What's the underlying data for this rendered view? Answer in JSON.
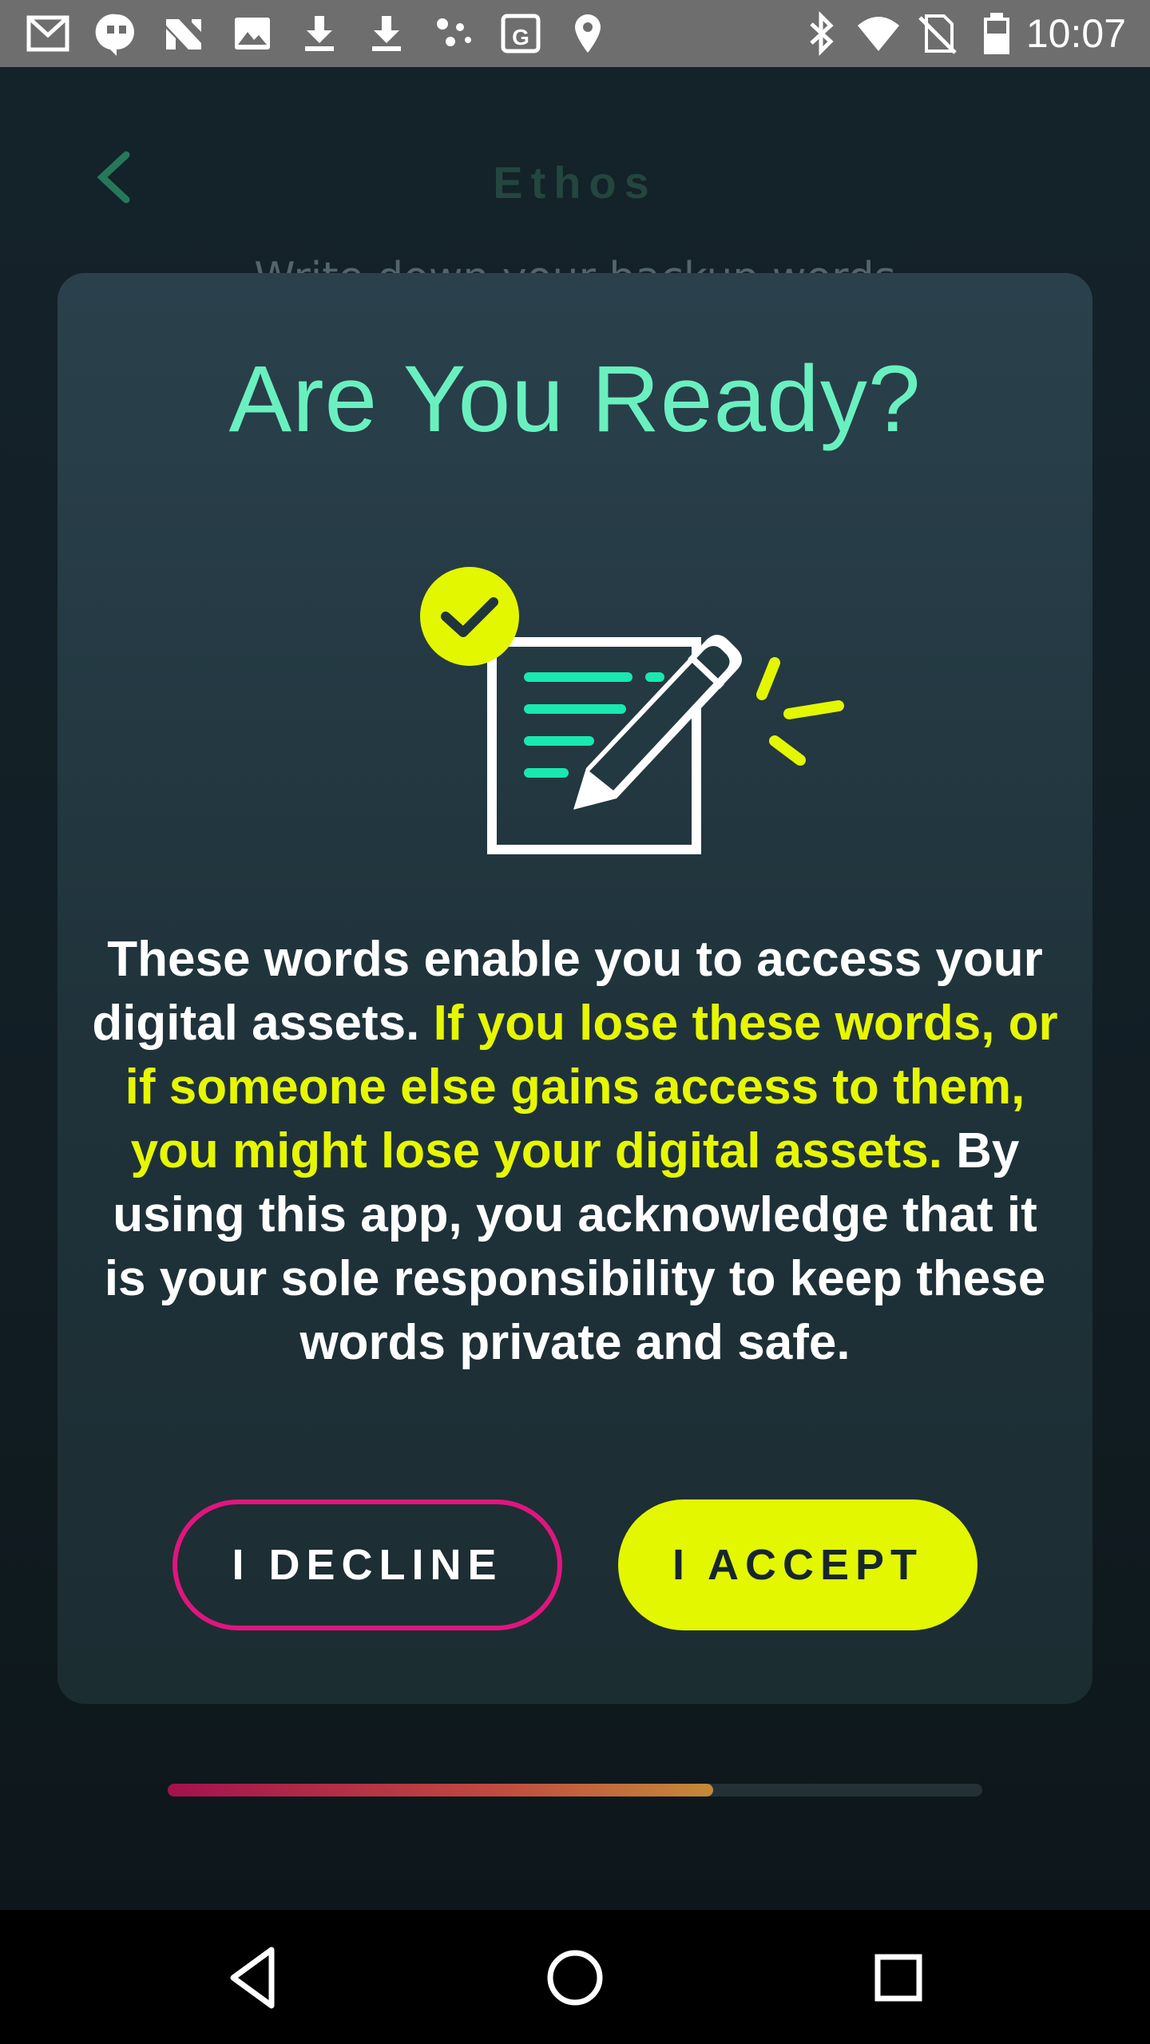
{
  "status_bar": {
    "time": "10:07",
    "left_icons": [
      "gmail-icon",
      "hangouts-icon",
      "news-icon",
      "image-icon",
      "download-icon",
      "download-icon",
      "dots-icon",
      "maps-icon",
      "location-icon"
    ],
    "right_icons": [
      "bluetooth-icon",
      "wifi-icon",
      "no-sim-icon",
      "battery-icon"
    ]
  },
  "header": {
    "title": "Ethos",
    "behind_text": "Write down your backup words"
  },
  "modal": {
    "title": "Are You Ready?",
    "body_start": "These words enable you to access your digital assets. ",
    "body_warning": "If you lose these words, or if someone else gains access to them, you might lose your digital assets.",
    "body_end": " By using this app, you acknowledge that it is your sole responsibility to keep these words private and safe.",
    "decline_label": "I DECLINE",
    "accept_label": "I ACCEPT",
    "illustration_icon": "signed-document-icon"
  },
  "progress": {
    "fraction": 0.67
  },
  "colors": {
    "accent_green": "#6af0bf",
    "warning_yellow": "#e6f700",
    "decline_pink": "#e0157e",
    "accept_yellow": "#e3f700"
  }
}
